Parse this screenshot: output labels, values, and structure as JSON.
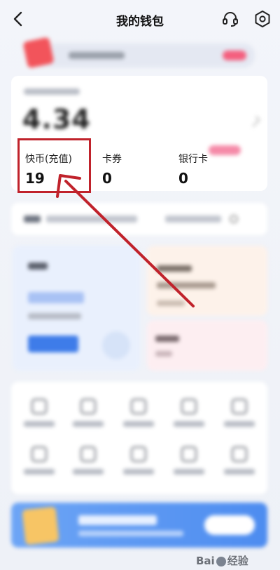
{
  "header": {
    "title": "我的钱包",
    "back_icon": "back-arrow-icon",
    "support_icon": "headset-icon",
    "settings_icon": "gear-icon"
  },
  "wallet": {
    "balance": "4.34",
    "stats": [
      {
        "label": "快币(充值)",
        "value": "19"
      },
      {
        "label": "卡券",
        "value": "0"
      },
      {
        "label": "银行卡",
        "value": "0"
      }
    ]
  },
  "annotation": {
    "highlight_color": "#c0222b"
  },
  "watermark": {
    "text_left": "Bai",
    "text_right": "经验"
  }
}
